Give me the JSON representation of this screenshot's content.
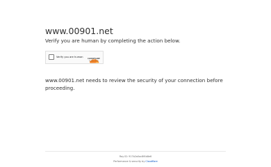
{
  "header": {
    "site_name": "www.00901.net",
    "subtitle": "Verify you are human by completing the action below."
  },
  "challenge_widget": {
    "checkbox_label": "Verify you are human",
    "brand_name": "CLOUDFLARE",
    "privacy_link": "Privacy",
    "terms_link": "Terms",
    "link_separator": " - ",
    "brand_color": "#f38020"
  },
  "main": {
    "message": "www.00901.net needs to review the security of your connection before proceeding."
  },
  "footer": {
    "ray_id_label": "Ray ID: ",
    "ray_id_value": "917b2a0ac8f4b8e6",
    "performance_text": "Performance & security by ",
    "performance_link": "Cloudflare",
    "link_color": "#0051c3"
  }
}
